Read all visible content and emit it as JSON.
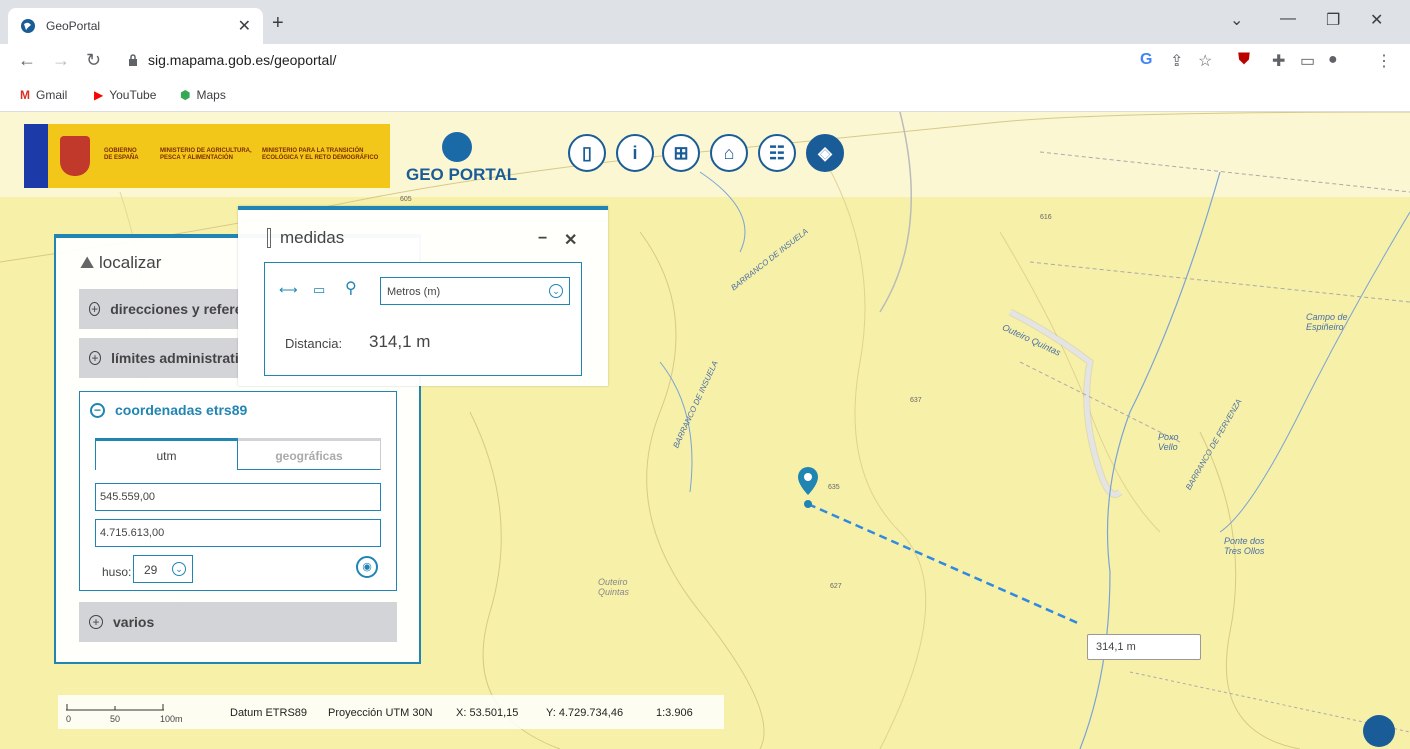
{
  "browser": {
    "tab_title": "GeoPortal",
    "url": "sig.mapama.gob.es/geoportal/",
    "bookmarks": [
      "Gmail",
      "YouTube",
      "Maps"
    ]
  },
  "header": {
    "gov_label_1": "GOBIERNO DE ESPAÑA",
    "gov_label_2": "MINISTERIO DE AGRICULTURA, PESCA Y ALIMENTACIÓN",
    "gov_label_3": "MINISTERIO PARA LA TRANSICIÓN ECOLÓGICA Y EL RETO DEMOGRÁFICO",
    "app_title": "GEO PORTAL"
  },
  "localizar": {
    "title": "localizar",
    "sections": [
      "direcciones y referencias",
      "límites administrativos",
      "coordenadas etrs89",
      "varios"
    ],
    "tabs": [
      "utm",
      "geográficas"
    ],
    "x_value": "545.559,00",
    "y_value": "4.715.613,00",
    "huso_label": "huso:",
    "huso_value": "29"
  },
  "medidas": {
    "title": "medidas",
    "units": "Metros (m)",
    "distance_label": "Distancia:",
    "distance_value": "314,1 m"
  },
  "map": {
    "measure_label": "314,1 m",
    "labels": [
      "BARRANCO DE INSUELA",
      "Outeiro Quintas",
      "Campo de Espiñeiro",
      "Poxo Vello",
      "BARRANCO DE FERVENZA",
      "Ponte dos Tres Ollos",
      "Outeiro Quintas"
    ],
    "spot_heights": [
      "605",
      "616",
      "637",
      "635",
      "627"
    ]
  },
  "status": {
    "datum": "Datum ETRS89",
    "projection": "Proyección UTM 30N",
    "x": "X: 53.501,15",
    "y": "Y: 4.729.734,46",
    "scale": "1:3.906",
    "scale_ticks": [
      "0",
      "50",
      "100m"
    ]
  }
}
